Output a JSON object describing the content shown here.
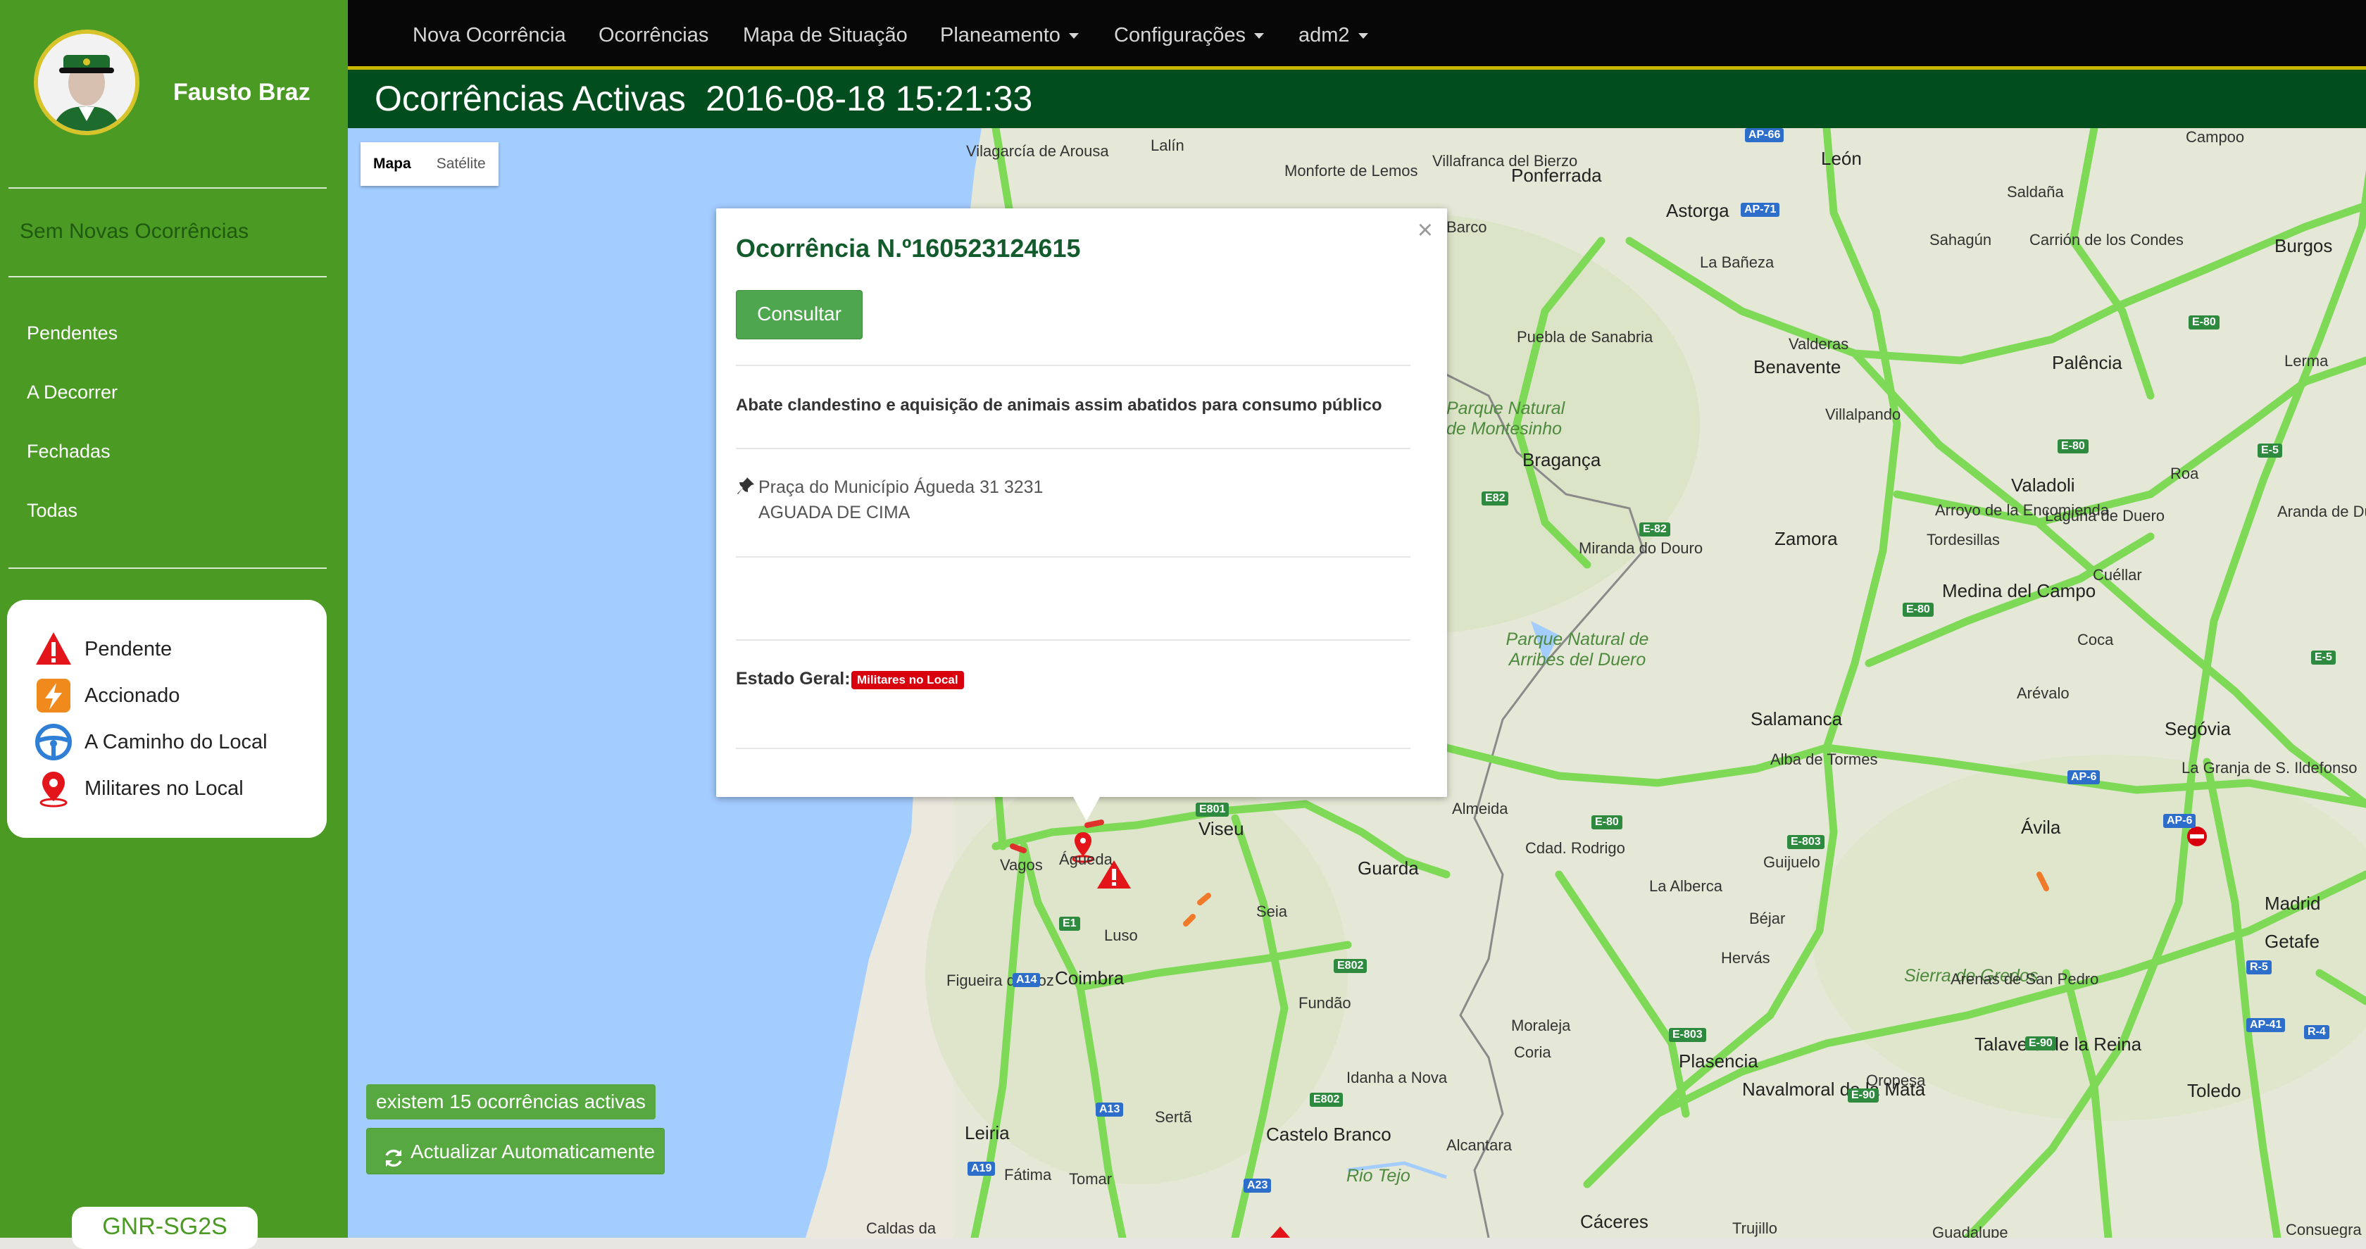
{
  "sidebar": {
    "username": "Fausto Braz",
    "no_new": "Sem Novas Ocorrências",
    "links": [
      "Pendentes",
      "A Decorrer",
      "Fechadas",
      "Todas"
    ],
    "legend": [
      {
        "label": "Pendente",
        "icon": "warning-triangle-icon"
      },
      {
        "label": "Accionado",
        "icon": "lightning-icon"
      },
      {
        "label": "A Caminho do Local",
        "icon": "steering-wheel-icon"
      },
      {
        "label": "Militares no Local",
        "icon": "location-pin-icon"
      }
    ],
    "system": "GNR-SG2S"
  },
  "navbar": {
    "items": [
      "Nova Ocorrência",
      "Ocorrências",
      "Mapa de Situação",
      "Planeamento",
      "Configurações",
      "adm2"
    ]
  },
  "header": {
    "title": "Ocorrências Activas",
    "datetime": "2016-08-18 15:21:33"
  },
  "map": {
    "type_buttons": [
      "Mapa",
      "Satélite"
    ],
    "places": [
      "Lalín",
      "Vilagarcía de Arousa",
      "Monforte de Lemos",
      "Villafranca del Bierzo",
      "Ponferrada",
      "León",
      "Astorga",
      "La Bañeza",
      "Sahagún",
      "Carrión de los Condes",
      "Burgos",
      "Saldaña",
      "Campoo",
      "Barco",
      "Puebla de Sanabria",
      "Valderas",
      "Benavente",
      "Palência",
      "Lerma",
      "Villalpando",
      "Bragança",
      "Miranda do Douro",
      "Zamora",
      "Arroyo de la Encomienda",
      "Valadoli",
      "Laguna de Duero",
      "Tordesillas",
      "Aranda de Duero",
      "Roa",
      "Cuéllar",
      "Medina del Campo",
      "Coca",
      "Salamanca",
      "Arévalo",
      "Segóvia",
      "Alba de Tormes",
      "La Granja de S. Ildefonso",
      "Ávila",
      "Almeida",
      "Viseu",
      "Guarda",
      "Cdad. Rodrigo",
      "Guijuelo",
      "Vagos",
      "Águeda",
      "Seia",
      "La Alberca",
      "Béjar",
      "Madrid",
      "Getafe",
      "Luso",
      "Figueira da Foz",
      "Coimbra",
      "Fundão",
      "Hervás",
      "Sierra de Gredos",
      "Arenas de San Pedro",
      "Moraleja",
      "Coria",
      "Plasencia",
      "Talavera de la Reina",
      "Idanha a Nova",
      "Oropesa",
      "Navalmoral de la Mata",
      "Toledo",
      "Sertã",
      "Castelo Branco",
      "Alcantara",
      "Leiria",
      "Fátima",
      "Tomar",
      "Cáceres",
      "Trujillo",
      "Caldas da",
      "Guadalupe",
      "Consuegra",
      "Parque Natural de Montesinho",
      "Parque Natural de Arribes del Duero",
      "Rio Tejo"
    ],
    "road_tags": [
      "AP-66",
      "AP-71",
      "E-80",
      "E82",
      "E-82",
      "E-80",
      "E-5",
      "E-80",
      "E-5",
      "AP-6",
      "E801",
      "E-803",
      "E-80",
      "A14",
      "E1",
      "E802",
      "E-803",
      "E-90",
      "R-5",
      "AP-41",
      "R-4",
      "A13",
      "E802",
      "A19",
      "A23",
      "E-90",
      "AP-6"
    ]
  },
  "popup": {
    "title": "Ocorrência N.º160523124615",
    "button": "Consultar",
    "description": "Abate clandestino e aquisição de animais assim abatidos para consumo público",
    "address_line1": "Praça do Município Águeda 31 3231",
    "address_line2": "AGUADA DE CIMA",
    "status_label": "Estado Geral:",
    "status_badge": "Militares no Local",
    "close": "×"
  },
  "footer": {
    "active_count": "existem 15 ocorrências activas",
    "auto_refresh": "Actualizar Automaticamente"
  },
  "colors": {
    "sidebar": "#4a9a24",
    "navbar": "#070707",
    "titlebar": "#024d1d",
    "accent": "#c9b600",
    "sea": "#a3ccff",
    "roads": "#7ed957",
    "status_red": "#d9000d"
  }
}
